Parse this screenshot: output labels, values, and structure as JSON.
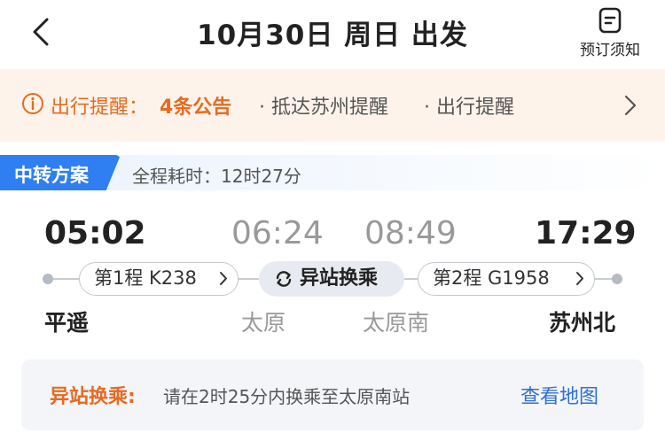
{
  "header": {
    "title": "10月30日 周日 出发",
    "notice_label": "预订须知"
  },
  "reminder": {
    "label": "出行提醒：",
    "count": "4条公告",
    "items": [
      "· 抵达苏州提醒",
      "· 出行提醒"
    ]
  },
  "plan": {
    "tag": "中转方案",
    "duration": "全程耗时：12时27分"
  },
  "itinerary": {
    "times": [
      "05:02",
      "06:24",
      "08:49",
      "17:29"
    ],
    "stations": [
      "平遥",
      "太原",
      "太原南",
      "苏州北"
    ],
    "segment1": "第1程 K238",
    "segment2": "第2程 G1958",
    "transfer": "异站换乘"
  },
  "bottom": {
    "label": "异站换乘:",
    "text": "请在2时25分内换乘至太原南站",
    "link": "查看地图"
  },
  "colors": {
    "accent_orange": "#e86a20",
    "accent_blue": "#2f7ff2",
    "link_blue": "#2f6fd6"
  }
}
